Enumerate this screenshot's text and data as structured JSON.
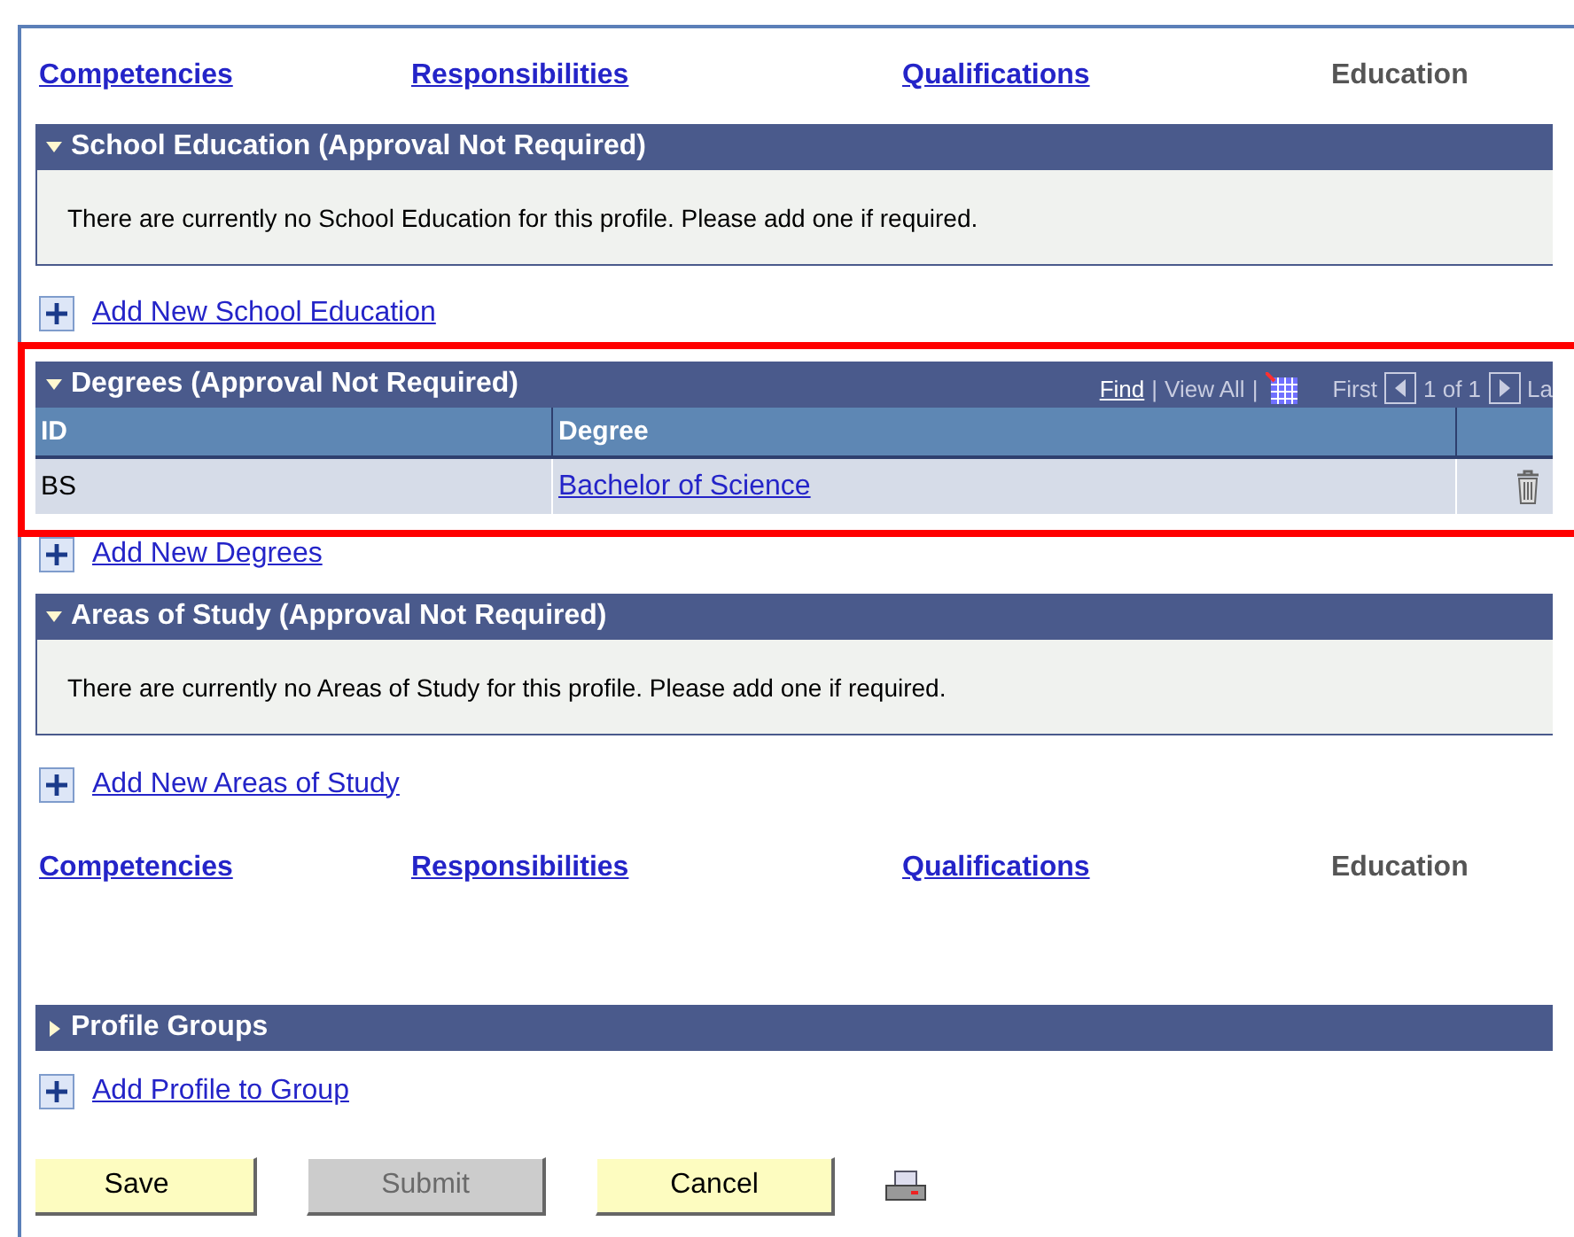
{
  "tabs_top": [
    {
      "label": "Competencies",
      "selected": false
    },
    {
      "label": "Responsibilities",
      "selected": false
    },
    {
      "label": "Qualifications",
      "selected": false
    },
    {
      "label": "Education",
      "selected": true
    }
  ],
  "school_education": {
    "title": "School Education (Approval Not Required)",
    "expanded": true,
    "message": "There are currently no School Education for this profile.  Please add one if required.",
    "add_link": "Add New School Education"
  },
  "degrees": {
    "title": "Degrees (Approval Not Required)",
    "expanded": true,
    "nav": {
      "find": "Find",
      "separator_1": "|",
      "view_all": "View All",
      "separator_2": "|",
      "first": "First",
      "count": "1 of 1",
      "last": "La"
    },
    "columns": [
      "ID",
      "Degree"
    ],
    "rows": [
      {
        "id": "BS",
        "degree": "Bachelor of Science"
      }
    ],
    "add_link": "Add New Degrees"
  },
  "areas_of_study": {
    "title": "Areas of Study (Approval Not Required)",
    "expanded": true,
    "message": "There are currently no Areas of Study for this profile.  Please add one if required.",
    "add_link": "Add New Areas of Study"
  },
  "tabs_bottom": [
    {
      "label": "Competencies",
      "selected": false
    },
    {
      "label": "Responsibilities",
      "selected": false
    },
    {
      "label": "Qualifications",
      "selected": false
    },
    {
      "label": "Education",
      "selected": true
    }
  ],
  "profile_groups": {
    "title": "Profile Groups",
    "expanded": false,
    "add_link": "Add Profile to Group"
  },
  "buttons": [
    {
      "label": "Save",
      "disabled": false
    },
    {
      "label": "Submit",
      "disabled": true
    },
    {
      "label": "Cancel",
      "disabled": false
    }
  ]
}
